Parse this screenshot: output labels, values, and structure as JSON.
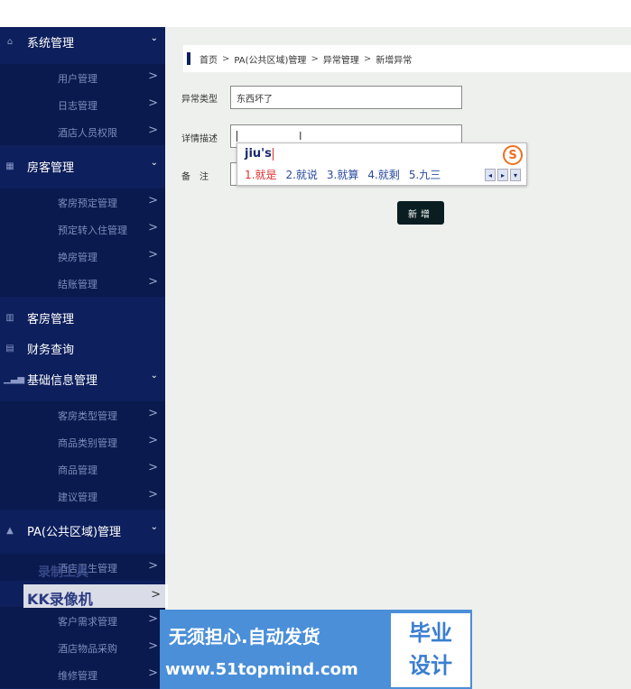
{
  "sidebar": {
    "groups": [
      {
        "label": "系统管理",
        "icon": "home-icon",
        "expanded": true
      },
      {
        "label": "房客管理",
        "icon": "grid-icon",
        "expanded": true
      },
      {
        "label": "客房管理",
        "icon": "building-icon",
        "expanded": false
      },
      {
        "label": "财务查询",
        "icon": "card-icon",
        "expanded": false
      },
      {
        "label": "基础信息管理",
        "icon": "bar-chart-icon",
        "expanded": true
      },
      {
        "label": "PA(公共区域)管理",
        "icon": "warning-icon",
        "expanded": true
      }
    ],
    "items": [
      {
        "label": "用户管理"
      },
      {
        "label": "日志管理"
      },
      {
        "label": "酒店人员权限"
      },
      {
        "label": "客房预定管理"
      },
      {
        "label": "预定转入住管理"
      },
      {
        "label": "换房管理"
      },
      {
        "label": "结账管理"
      },
      {
        "label": "客房类型管理"
      },
      {
        "label": "商品类别管理"
      },
      {
        "label": "商品管理"
      },
      {
        "label": "建议管理"
      },
      {
        "label": "酒店卫生管理"
      },
      {
        "label": "客户需求管理"
      },
      {
        "label": "酒店物品采购"
      },
      {
        "label": "维修管理"
      }
    ],
    "arrow": ">",
    "chevron": "⌄"
  },
  "breadcrumb": [
    "首页",
    "PA(公共区域)管理",
    "异常管理",
    "新增异常"
  ],
  "breadcrumb_sep": ">",
  "form": {
    "type_label": "异常类型",
    "type_value": "东西坏了",
    "desc_label": "详情描述",
    "remark_label": "备　注",
    "submit_label": "新增"
  },
  "ime": {
    "composition": "jiu's",
    "candidates": [
      "1.就是",
      "2.就说",
      "3.就算",
      "4.就剩",
      "5.九三"
    ],
    "logo": "S"
  },
  "watermarks": {
    "kk_line1": "录制工具",
    "kk_line2": "KK录像机",
    "banner_line1": "无须担心.自动发货",
    "banner_line2": "www.51topmind.com",
    "banner_side1": "毕业",
    "banner_side2": "设计"
  },
  "colors": {
    "sidebar_bg": "#0d1f5c",
    "submenu_bg": "#0a1a4e",
    "main_bg": "#eef0ee",
    "button_bg": "#0a1e22",
    "ime_highlight": "#e03030"
  }
}
